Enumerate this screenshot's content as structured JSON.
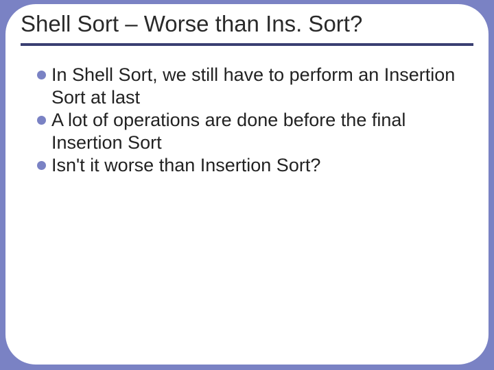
{
  "slide": {
    "title": "Shell Sort – Worse than Ins. Sort?",
    "bullets": [
      "In Shell Sort, we still have to perform an Insertion Sort at last",
      "A lot of operations are done before the final Insertion Sort",
      "Isn't it worse than Insertion Sort?"
    ]
  }
}
